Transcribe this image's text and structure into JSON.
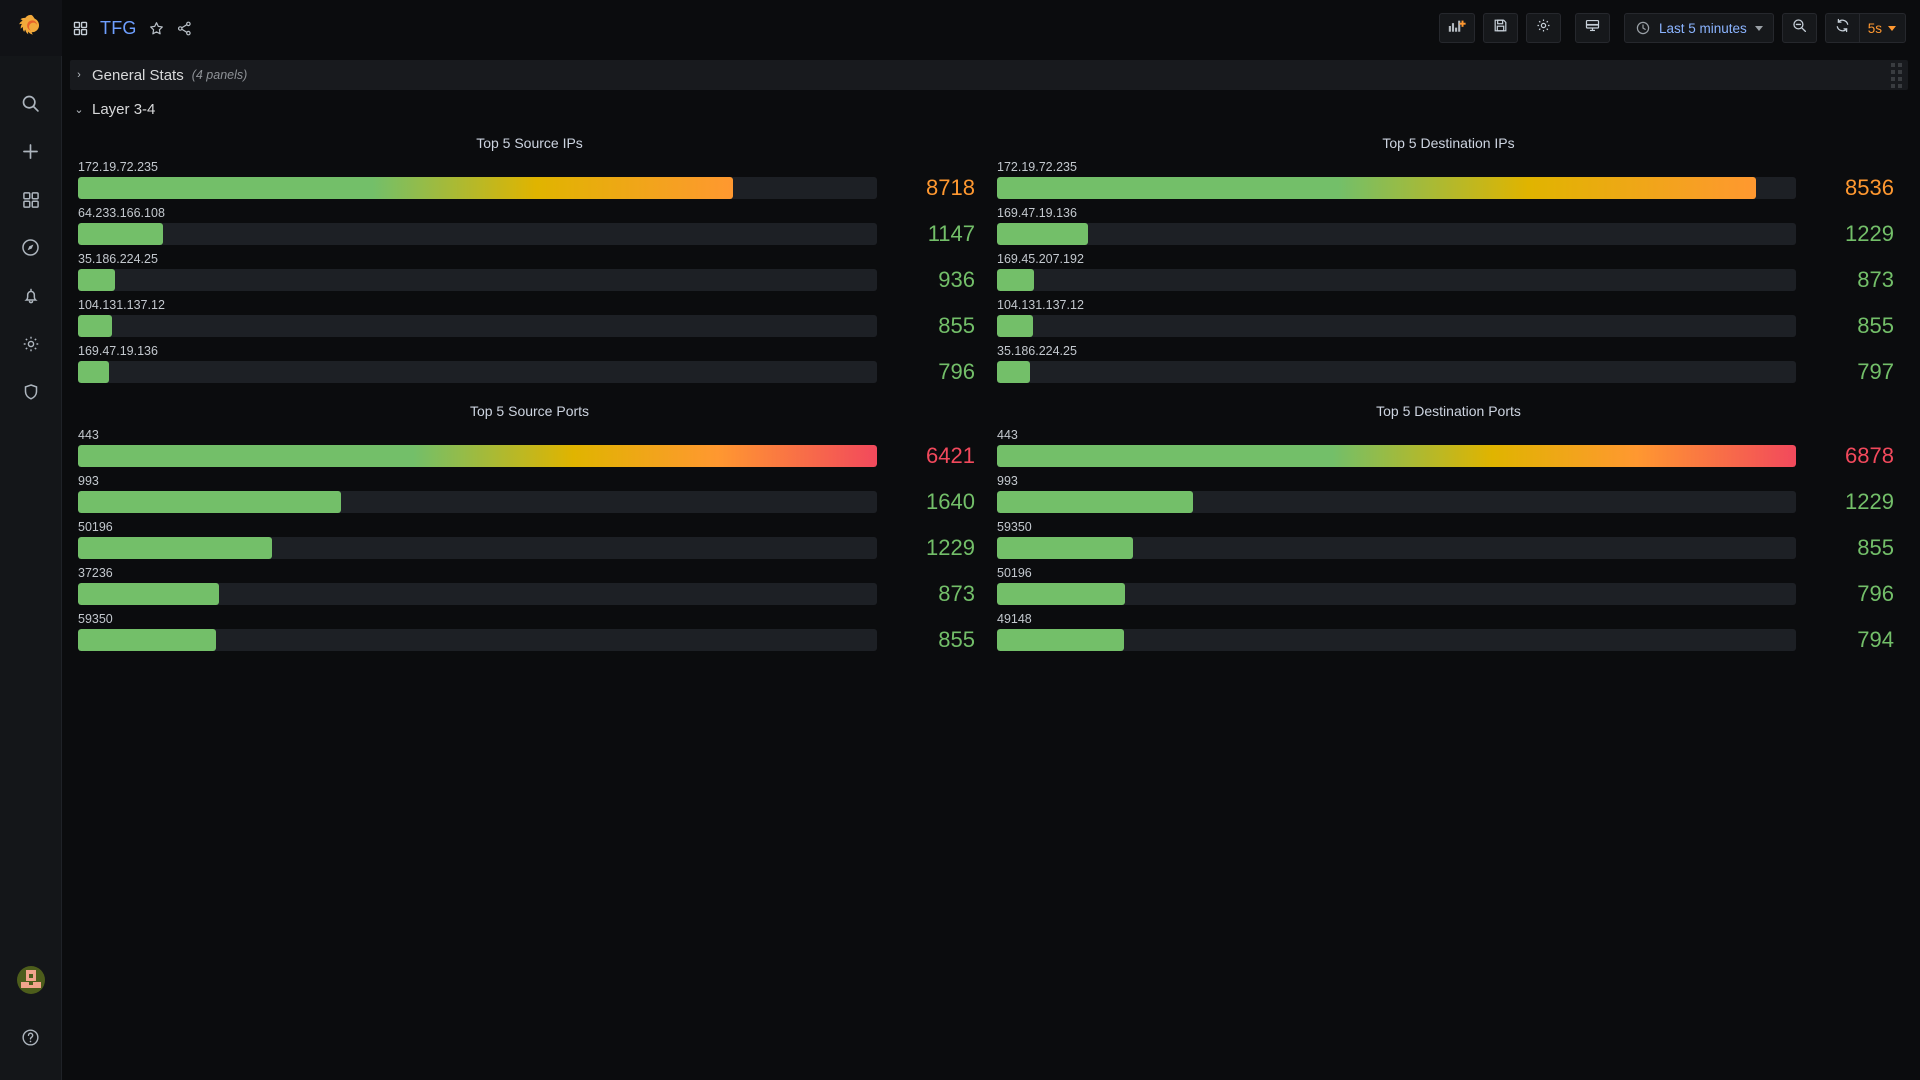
{
  "app": {
    "brand_icon": "grafana-logo-icon",
    "accent_orange": "#ff9830",
    "accent_blue": "#6e9fff",
    "bg": "#0b0c0e",
    "panel_bg": "#0b0c0e",
    "track_color": "#1d2025"
  },
  "sidebar": {
    "top_items": [
      {
        "name": "search",
        "icon": "search-icon"
      },
      {
        "name": "create",
        "icon": "plus-icon"
      },
      {
        "name": "dashboards",
        "icon": "dashboards-grid-icon"
      },
      {
        "name": "explore",
        "icon": "compass-icon"
      },
      {
        "name": "alerting",
        "icon": "bell-icon"
      },
      {
        "name": "configuration",
        "icon": "gear-icon"
      },
      {
        "name": "server-admin",
        "icon": "shield-icon"
      }
    ],
    "bottom_items": [
      {
        "name": "user-profile",
        "icon": "avatar"
      },
      {
        "name": "help",
        "icon": "question-circle-icon"
      }
    ]
  },
  "header": {
    "dashboard_icon": "dashboard-grid-icon",
    "title": "TFG",
    "star_icon": "star-outline-icon",
    "share_icon": "share-nodes-icon",
    "buttons": [
      {
        "name": "add-panel",
        "icon": "add-panel-icon",
        "label": ""
      },
      {
        "name": "save-dashboard",
        "icon": "save-floppy-icon",
        "label": ""
      },
      {
        "name": "dashboard-settings",
        "icon": "gear-icon",
        "label": ""
      },
      {
        "name": "tv-kiosk-mode",
        "icon": "tv-monitor-icon",
        "label": ""
      }
    ],
    "time_picker": {
      "icon": "clock-icon",
      "label": "Last 5 minutes",
      "chevron": "chevron-down-icon"
    },
    "zoom_out": {
      "icon": "zoom-out-magnifier-icon"
    },
    "refresh": {
      "icon": "refresh-circular-arrows-icon",
      "interval": "5s",
      "chevron": "chevron-down-icon"
    }
  },
  "rows": [
    {
      "name": "general-stats",
      "title": "General Stats",
      "count_label": "(4 panels)",
      "collapsed": true,
      "caret": "›"
    },
    {
      "name": "layer-3-4",
      "title": "Layer 3-4",
      "count_label": "",
      "collapsed": false,
      "caret": "⌄"
    }
  ],
  "chart_data": [
    {
      "type": "bar",
      "panel_name": "top-5-source-ips",
      "title": "Top 5 Source IPs",
      "orientation": "horizontal",
      "display": "bar-gauge-lcd",
      "xlabel": "",
      "ylabel": "",
      "max_scale": 8718,
      "categories": [
        "172.19.72.235",
        "64.233.166.108",
        "35.186.224.25",
        "104.131.137.12",
        "169.47.19.136"
      ],
      "values": [
        8718,
        1147,
        936,
        855,
        796
      ],
      "value_colors": [
        "#ff9830",
        "#73bf69",
        "#73bf69",
        "#73bf69",
        "#73bf69"
      ],
      "fill_pct": [
        82.0,
        10.6,
        4.6,
        4.2,
        3.9
      ]
    },
    {
      "type": "bar",
      "panel_name": "top-5-destination-ips",
      "title": "Top 5 Destination IPs",
      "orientation": "horizontal",
      "display": "bar-gauge-lcd",
      "xlabel": "",
      "ylabel": "",
      "max_scale": 8536,
      "categories": [
        "172.19.72.235",
        "169.47.19.136",
        "169.45.207.192",
        "104.131.137.12",
        "35.186.224.25"
      ],
      "values": [
        8536,
        1229,
        873,
        855,
        797
      ],
      "value_colors": [
        "#ff9830",
        "#73bf69",
        "#73bf69",
        "#73bf69",
        "#73bf69"
      ],
      "fill_pct": [
        95.0,
        11.4,
        4.6,
        4.5,
        4.1
      ]
    },
    {
      "type": "bar",
      "panel_name": "top-5-source-ports",
      "title": "Top 5 Source Ports",
      "orientation": "horizontal",
      "display": "bar-gauge-lcd",
      "xlabel": "",
      "ylabel": "",
      "max_scale": 6421,
      "categories": [
        "443",
        "993",
        "50196",
        "37236",
        "59350"
      ],
      "values": [
        6421,
        1640,
        1229,
        873,
        855
      ],
      "value_colors": [
        "#f2495c",
        "#73bf69",
        "#73bf69",
        "#73bf69",
        "#73bf69"
      ],
      "fill_pct": [
        100.0,
        32.9,
        24.3,
        17.6,
        17.3
      ]
    },
    {
      "type": "bar",
      "panel_name": "top-5-destination-ports",
      "title": "Top 5 Destination Ports",
      "orientation": "horizontal",
      "display": "bar-gauge-lcd",
      "xlabel": "",
      "ylabel": "",
      "max_scale": 6878,
      "categories": [
        "443",
        "993",
        "59350",
        "50196",
        "49148"
      ],
      "values": [
        6878,
        1229,
        855,
        796,
        794
      ],
      "value_colors": [
        "#f2495c",
        "#73bf69",
        "#73bf69",
        "#73bf69",
        "#73bf69"
      ],
      "fill_pct": [
        100.0,
        24.5,
        17.0,
        16.0,
        15.9
      ]
    }
  ]
}
